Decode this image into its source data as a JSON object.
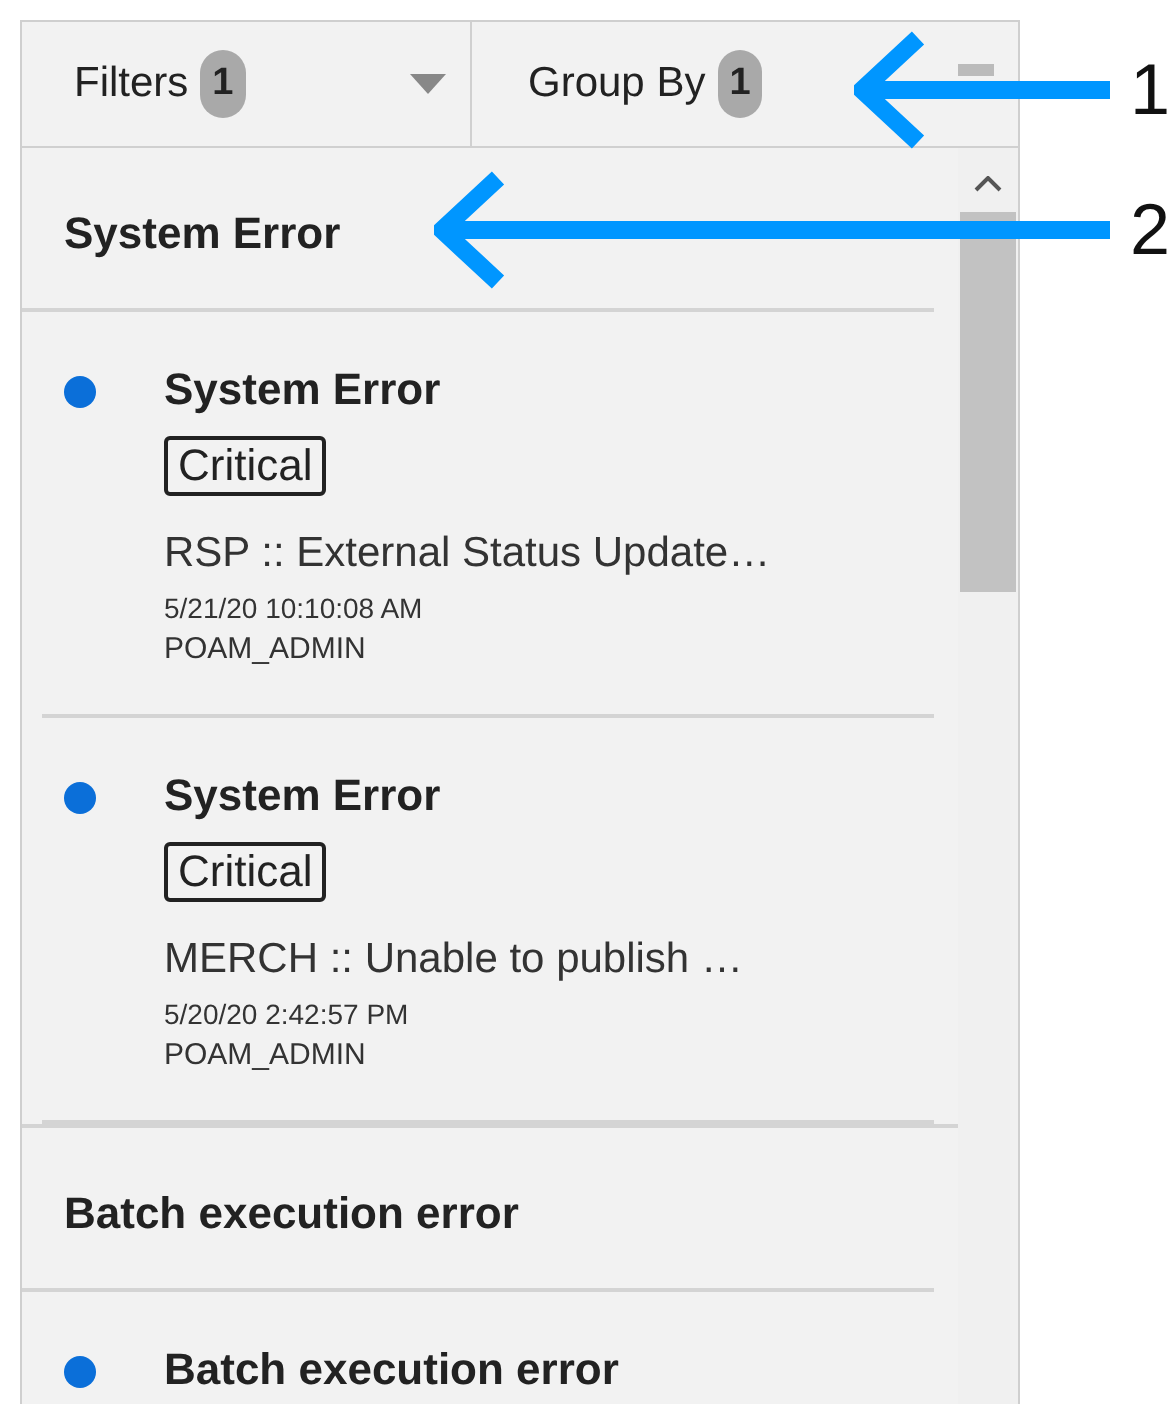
{
  "toolbar": {
    "filters": {
      "label": "Filters",
      "count": "1"
    },
    "group_by": {
      "label": "Group By",
      "count": "1"
    }
  },
  "groups": [
    {
      "heading": "System Error",
      "items": [
        {
          "title": "System Error",
          "severity": "Critical",
          "message": "RSP :: External Status Update…",
          "time": "5/21/20 10:10:08 AM",
          "user": "POAM_ADMIN",
          "unread": true
        },
        {
          "title": "System Error",
          "severity": "Critical",
          "message": "MERCH :: Unable to publish …",
          "time": "5/20/20 2:42:57 PM",
          "user": "POAM_ADMIN",
          "unread": true
        }
      ]
    },
    {
      "heading": "Batch execution error",
      "items": [
        {
          "title": "Batch execution error",
          "unread": true
        }
      ]
    }
  ],
  "callouts": [
    {
      "label": "1"
    },
    {
      "label": "2"
    }
  ]
}
